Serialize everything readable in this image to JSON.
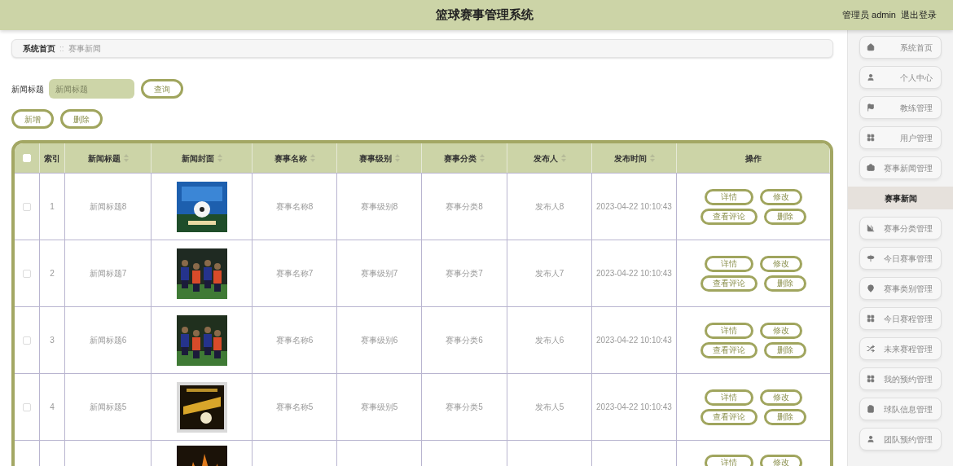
{
  "header": {
    "title": "篮球赛事管理系统",
    "user": "管理员 admin",
    "logout": "退出登录"
  },
  "breadcrumb": [
    "系统首页",
    "赛事新闻"
  ],
  "breadcrumb_separator": "::",
  "search": {
    "label": "新闻标题",
    "placeholder": "新闻标题",
    "button": "查询"
  },
  "actions": [
    "新增",
    "删除"
  ],
  "table": {
    "select_all_checked": false,
    "columns": [
      {
        "label": "索引",
        "sortable": false
      },
      {
        "label": "新闻标题",
        "sortable": true
      },
      {
        "label": "新闻封面",
        "sortable": true
      },
      {
        "label": "赛事名称",
        "sortable": true
      },
      {
        "label": "赛事级别",
        "sortable": true
      },
      {
        "label": "赛事分类",
        "sortable": true
      },
      {
        "label": "发布人",
        "sortable": true
      },
      {
        "label": "发布时间",
        "sortable": true
      },
      {
        "label": "操作",
        "sortable": false
      }
    ],
    "rows": [
      {
        "checked": false,
        "index": "1",
        "title": "新闻标题8",
        "name": "赛事名称8",
        "level_name": "赛事级别8",
        "category": "赛事分类8",
        "publisher": "发布人8",
        "time": "2023-04-22 10:10:43",
        "buttons": [
          "详情",
          "修改",
          "查看评论",
          "删除"
        ]
      },
      {
        "checked": false,
        "index": "2",
        "title": "新闻标题7",
        "name": "赛事名称7",
        "level_name": "赛事级别7",
        "category": "赛事分类7",
        "publisher": "发布人7",
        "time": "2023-04-22 10:10:43",
        "buttons": [
          "详情",
          "修改",
          "查看评论",
          "删除"
        ]
      },
      {
        "checked": false,
        "index": "3",
        "title": "新闻标题6",
        "name": "赛事名称6",
        "level_name": "赛事级别6",
        "category": "赛事分类6",
        "publisher": "发布人6",
        "time": "2023-04-22 10:10:43",
        "buttons": [
          "详情",
          "修改",
          "查看评论",
          "删除"
        ]
      },
      {
        "checked": false,
        "index": "4",
        "title": "新闻标题5",
        "name": "赛事名称5",
        "level_name": "赛事级别5",
        "category": "赛事分类5",
        "publisher": "发布人5",
        "time": "2023-04-22 10:10:43",
        "buttons": [
          "详情",
          "修改",
          "查看评论",
          "删除"
        ]
      }
    ],
    "cut_row": {
      "buttons": [
        "详情",
        "修改"
      ]
    }
  },
  "sidebar": {
    "items": [
      {
        "kind": "parent",
        "label": "系统首页",
        "selected": false
      },
      {
        "kind": "parent",
        "label": "个人中心",
        "selected": false
      },
      {
        "kind": "parent",
        "label": "教练管理",
        "selected": false
      },
      {
        "kind": "parent",
        "label": "用户管理",
        "selected": false
      },
      {
        "kind": "parent",
        "label": "赛事新闻管理",
        "selected": false
      },
      {
        "kind": "child",
        "label": "赛事新闻",
        "selected": true
      },
      {
        "kind": "parent",
        "label": "赛事分类管理",
        "selected": false
      },
      {
        "kind": "parent",
        "label": "今日赛事管理",
        "selected": false
      },
      {
        "kind": "parent",
        "label": "赛事类别管理",
        "selected": false
      },
      {
        "kind": "parent",
        "label": "今日赛程管理",
        "selected": false
      },
      {
        "kind": "parent",
        "label": "未来赛程管理",
        "selected": false
      },
      {
        "kind": "parent",
        "label": "我的预约管理",
        "selected": false
      },
      {
        "kind": "parent",
        "label": "球队信息管理",
        "selected": false
      },
      {
        "kind": "parent",
        "label": "团队预约管理",
        "selected": false
      }
    ]
  }
}
